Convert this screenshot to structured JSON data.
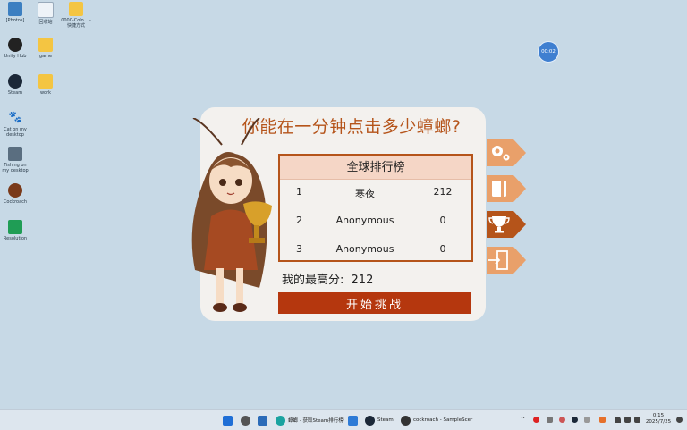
{
  "desktop": {
    "icons": [
      {
        "label": "[Photos]",
        "icon": "photo-icon"
      },
      {
        "label": "回收站",
        "icon": "recycle-bin-icon"
      },
      {
        "label": "0000-Colo... - 快捷方式",
        "icon": "folder-icon"
      },
      {
        "label": "Unity Hub",
        "icon": "unity-hub-icon"
      },
      {
        "label": "game",
        "icon": "folder-icon"
      },
      {
        "label": "Steam",
        "icon": "steam-icon"
      },
      {
        "label": "work",
        "icon": "folder-icon"
      },
      {
        "label": "Cat on my desktop",
        "icon": "paw-icon"
      },
      {
        "label": "Fishing on my desktop",
        "icon": "fishing-icon"
      },
      {
        "label": "Cockroach",
        "icon": "cockroach-icon"
      },
      {
        "label": "Resolution",
        "icon": "sheet-icon"
      }
    ],
    "timer": "00:02"
  },
  "game": {
    "title": "你能在一分钟点击多少蟑螂?",
    "leaderboard_title": "全球排行榜",
    "leaderboard": [
      {
        "rank": "1",
        "name": "寒夜",
        "score": "212"
      },
      {
        "rank": "2",
        "name": "Anonymous",
        "score": "0"
      },
      {
        "rank": "3",
        "name": "Anonymous",
        "score": "0"
      }
    ],
    "best_score_label": "我的最高分:",
    "best_score": "212",
    "start_button": "开始挑战",
    "side_tabs": [
      "settings-icon",
      "book-icon",
      "trophy-icon",
      "exit-icon"
    ]
  },
  "taskbar": {
    "apps": [
      {
        "label": "蟑螂 - 获取Steam排行榜",
        "icon": "edge-icon"
      },
      {
        "label": "Steam",
        "icon": "steam-icon"
      },
      {
        "label": "cockroach - SampleScer",
        "icon": "unity-icon"
      }
    ],
    "time": "0:15",
    "date": "2025/7/25"
  },
  "colors": {
    "accent": "#b5541a",
    "button": "#b5370e",
    "desktop": "#c7d9e6"
  }
}
